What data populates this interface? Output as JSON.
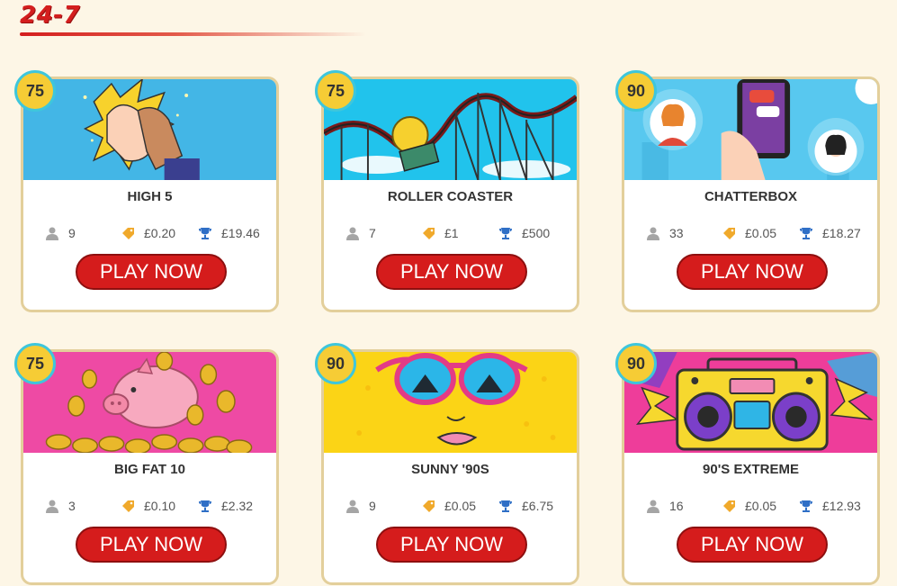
{
  "section": {
    "title": "24-7"
  },
  "colors": {
    "accent": "#d51c1c",
    "badge": "#f6cc35",
    "badge_ring": "#3ec6dc",
    "card_border": "#e3cf9b"
  },
  "rooms": [
    {
      "badge": "75",
      "name": "HIGH 5",
      "players": "9",
      "price": "£0.20",
      "prize": "£19.46",
      "button": "PLAY NOW",
      "image": "high-five-hands"
    },
    {
      "badge": "75",
      "name": "ROLLER COASTER",
      "players": "7",
      "price": "£1",
      "prize": "£500",
      "button": "PLAY NOW",
      "image": "roller-coaster"
    },
    {
      "badge": "90",
      "name": "CHATTERBOX",
      "players": "33",
      "price": "£0.05",
      "prize": "£18.27",
      "button": "PLAY NOW",
      "image": "phone-chat"
    },
    {
      "badge": "75",
      "name": "BIG FAT 10",
      "players": "3",
      "price": "£0.10",
      "prize": "£2.32",
      "button": "PLAY NOW",
      "image": "piggy-bank"
    },
    {
      "badge": "90",
      "name": "SUNNY '90S",
      "players": "9",
      "price": "£0.05",
      "prize": "£6.75",
      "button": "PLAY NOW",
      "image": "sunglasses-face"
    },
    {
      "badge": "90",
      "name": "90'S EXTREME",
      "players": "16",
      "price": "£0.05",
      "prize": "£12.93",
      "button": "PLAY NOW",
      "image": "boombox"
    }
  ]
}
